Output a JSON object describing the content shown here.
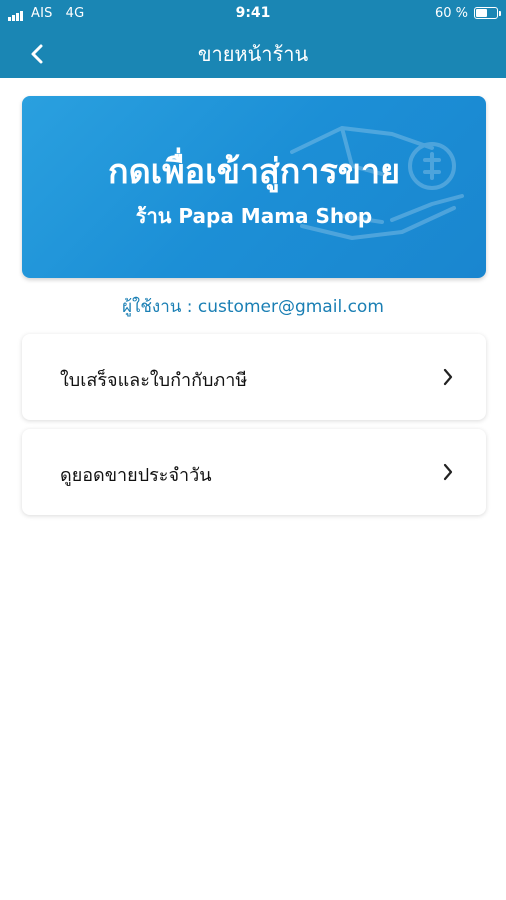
{
  "status_bar": {
    "carrier": "AIS",
    "network": "4G",
    "time": "9:41",
    "battery_percent": "60 %",
    "battery_level": 0.6
  },
  "header": {
    "title": "ขายหน้าร้าน",
    "back_icon": "chevron-left-icon",
    "background_color": "#1a86b4"
  },
  "banner": {
    "title": "กดเพื่อเข้าสู่การขาย",
    "subtitle": "ร้าน Papa Mama Shop",
    "icon": "hand-coin-icon",
    "background_color": "#1c8fd6"
  },
  "user": {
    "text": "ผู้ใช้งาน : customer@gmail.com",
    "color": "#1a7fb4"
  },
  "menu": {
    "items": [
      {
        "label": "ใบเสร็จและใบกำกับภาษี",
        "icon": "chevron-right-icon"
      },
      {
        "label": "ดูยอดขายประจำวัน",
        "icon": "chevron-right-icon"
      }
    ]
  }
}
